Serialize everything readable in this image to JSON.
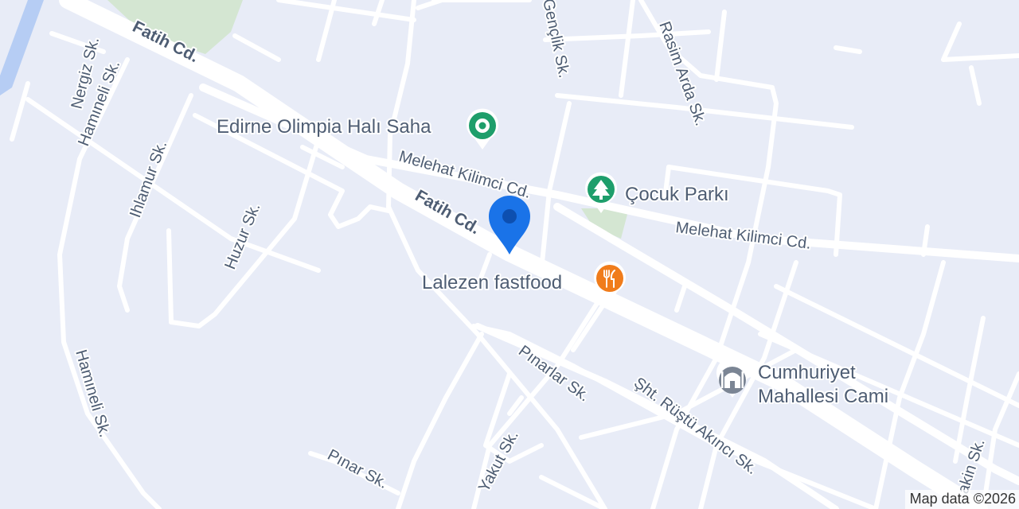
{
  "colors": {
    "background": "#e8ecf7",
    "road": "#ffffff",
    "park": "#d4e6d2",
    "water": "#b6cdf4",
    "label_text": "#4e5d73",
    "pin_blue": "#1a73e8",
    "poi_green": "#1e9e6b",
    "poi_orange": "#f07c1b",
    "poi_gray": "#7b8594"
  },
  "roads": {
    "fatih_1": "Fatih Cd.",
    "fatih_2": "Fatih Cd.",
    "melehat_1": "Melehat Kilimci Cd.",
    "melehat_2": "Melehat Kilimci Cd.",
    "nergiz": "Nergiz Sk.",
    "hamineli_1": "Hamıneli Sk.",
    "hamineli_2": "Hamıneli Sk.",
    "ihlamur": "Ihlamur Sk.",
    "huzur": "Huzur Sk.",
    "genclik": "Gençlik Sk.",
    "rasim_arda": "Rasim Arda Sk.",
    "pinarlar": "Pınarlar Sk.",
    "sht_rustu": "Şht. Rüştü Akıncı Sk.",
    "yakut": "Yakut Sk.",
    "pinar": "Pınar Sk.",
    "akin": "akin Sk."
  },
  "pois": {
    "halisaha": {
      "name": "Edirne Olimpia Halı Saha",
      "icon": "soccer-field-icon"
    },
    "cocuk_parki": {
      "name": "Çocuk Parkı",
      "icon": "tree-icon"
    },
    "lalezen": {
      "name": "Lalezen fastfood",
      "icon": "restaurant-icon"
    },
    "cami": {
      "name_line1": "Cumhuriyet",
      "name_line2": "Mahallesi Cami",
      "icon": "mosque-icon"
    }
  },
  "pin": {
    "icon": "location-pin-icon"
  },
  "attribution": "Map data ©2026"
}
